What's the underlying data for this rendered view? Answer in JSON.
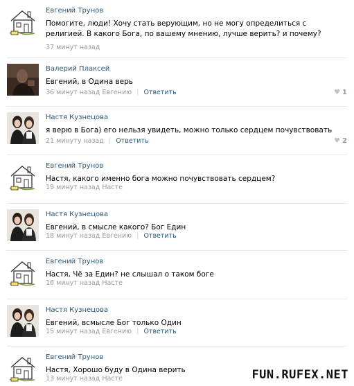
{
  "comments": [
    {
      "author": "Евгений Трунов",
      "avatar": "house-drawing-icon",
      "text": "Помогите, люди! Хочу стать верующим, но не могу определиться с религией. В какого Бога, по вашему мнению, лучше верить? и почему?",
      "time": "37 минут назад",
      "to": "",
      "reply": "",
      "likes": ""
    },
    {
      "author": "Валерий Плаксей",
      "avatar": "dark-photo-avatar",
      "text": "Евгений, в Одина верь",
      "time": "36 минут назад",
      "to": "Евгению",
      "reply": "Ответить",
      "likes": "1"
    },
    {
      "author": "Настя Кузнецова",
      "avatar": "girls-photo-avatar",
      "text": "я верю в Бога) его нельзя увидеть, можно только сердцем почувствовать",
      "time": "21 минуту назад",
      "to": "",
      "reply": "Ответить",
      "likes": "2"
    },
    {
      "author": "Евгений Трунов",
      "avatar": "house-drawing-icon",
      "text": "Настя, какого именно бога можно почувствовать сердцем?",
      "time": "19 минут назад",
      "to": "Насте",
      "reply": "",
      "likes": ""
    },
    {
      "author": "Настя Кузнецова",
      "avatar": "girls-photo-avatar",
      "text": "Евгений, в смысле какого? Бог Един",
      "time": "18 минут назад",
      "to": "Евгению",
      "reply": "Ответить",
      "likes": ""
    },
    {
      "author": "Евгений Трунов",
      "avatar": "house-drawing-icon",
      "text": "Настя, Чё за Един? не слышал о таком боге",
      "time": "16 минут назад",
      "to": "Насте",
      "reply": "",
      "likes": ""
    },
    {
      "author": "Настя Кузнецова",
      "avatar": "girls-photo-avatar",
      "text": "Евгений, всмысле Бог только Один",
      "time": "15 минут назад",
      "to": "Евгению",
      "reply": "Ответить",
      "likes": ""
    },
    {
      "author": "Евгений Трунов",
      "avatar": "house-drawing-icon",
      "text": "Настя, Хорошо буду в Одина верить",
      "time": "13 минут назад",
      "to": "Насте",
      "reply": "",
      "likes": ""
    }
  ],
  "watermark": "FUN.RUFEX.NET",
  "colors": {
    "author": "#2b587a",
    "meta": "#999999",
    "divider": "#e7e8ec"
  }
}
